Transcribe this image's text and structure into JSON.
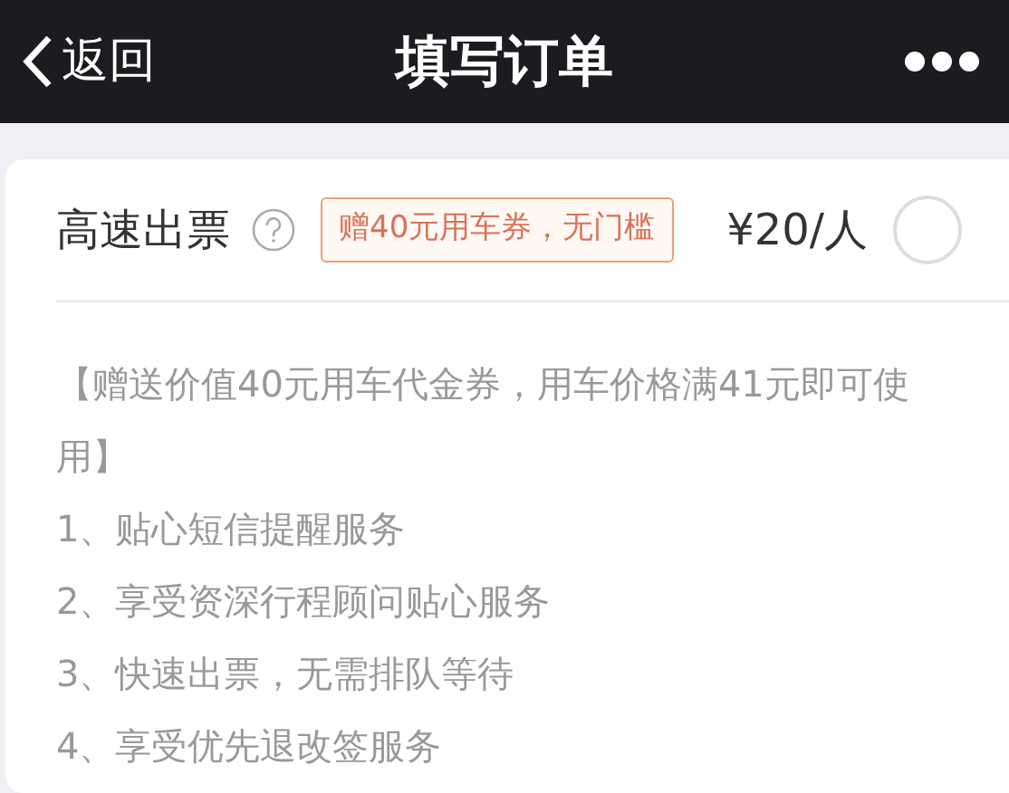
{
  "nav_bar": {
    "back_label": "返回",
    "title": "填写订单"
  },
  "option": {
    "label": "高速出票",
    "tag": "赠40元用车券，无门槛",
    "price": "¥20/人",
    "selected": false
  },
  "description": {
    "note": "【赠送价值40元用车代金券，用车价格满41元即可使用】",
    "items": [
      "1、贴心短信提醒服务",
      "2、享受资深行程顾问贴心服务",
      "3、快速出票，无需排队等待",
      "4、享受优先退改签服务"
    ]
  }
}
